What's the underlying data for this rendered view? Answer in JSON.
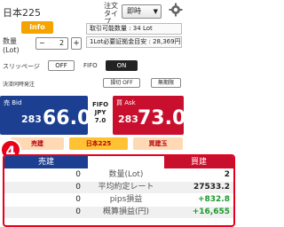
{
  "header": {
    "title": "日本225",
    "order_type_label": "注文\nタイプ",
    "order_type_value": "即時"
  },
  "info": {
    "info_label": "info",
    "qty_label": "数量\n(Lot)",
    "qty_minus": "−",
    "qty_value": "2",
    "qty_plus": "+",
    "orderable_text": "取引可能数量 : 34 Lot",
    "margin_text": "1Lot必要証拠金目安 : 28,369円"
  },
  "options": {
    "slippage_label": "スリッページ",
    "slippage_value": "OFF",
    "fifo_label": "FIFO",
    "fifo_value": "ON",
    "settle_label": "決済同時発注",
    "settle_btn1": "損切 OFF",
    "settle_btn2": "無期限"
  },
  "prices": {
    "bid_label": "売 Bid",
    "bid_small": "283",
    "bid_big": "66.0",
    "ask_label": "買 Ask",
    "ask_small": "283",
    "ask_big": "73.0",
    "mid_text": "FIFO\nJPY\n7.0"
  },
  "actions": {
    "left": "売建",
    "center": "日本225",
    "right": "買建玉"
  },
  "badge": "4",
  "positions": {
    "col_left": "売建",
    "col_right": "買建",
    "rows": [
      {
        "left": "0",
        "label": "数量(Lot)",
        "right": "2",
        "right_color": "#222"
      },
      {
        "left": "0",
        "label": "平均約定レート",
        "right": "27533.2",
        "right_color": "#222"
      },
      {
        "left": "0",
        "label": "pips損益",
        "right": "+832.8",
        "right_color": "#1a9a2a"
      },
      {
        "left": "0",
        "label": "概算損益(円)",
        "right": "+16,655",
        "right_color": "#1a9a2a"
      }
    ]
  },
  "colors": {
    "bid": "#1c3f91",
    "ask": "#c8102e",
    "highlight": "#e8001a",
    "info": "#f4a300"
  },
  "icons": {
    "settings": "gear-icon",
    "dropdown": "chevron-down-icon"
  }
}
